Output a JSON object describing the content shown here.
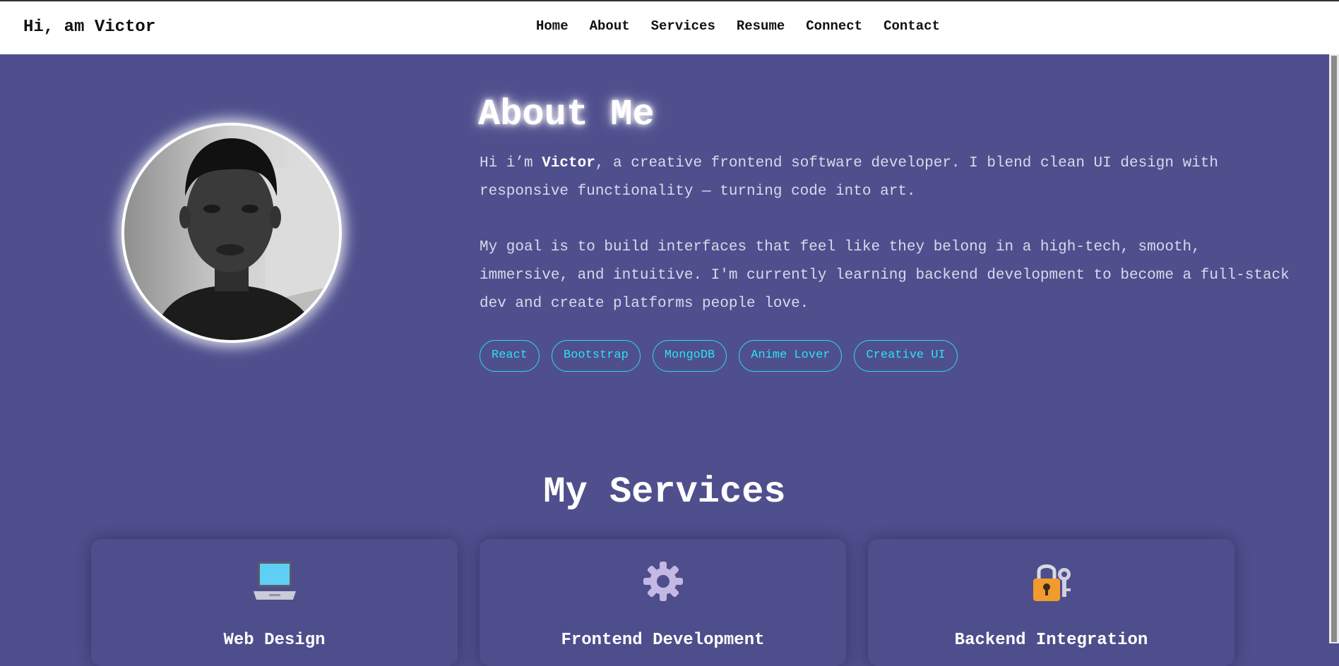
{
  "header": {
    "brand": "Hi, am Victor",
    "nav": [
      "Home",
      "About",
      "Services",
      "Resume",
      "Connect",
      "Contact"
    ]
  },
  "about": {
    "title": "About Me",
    "intro_prefix": "Hi i’m ",
    "intro_name": "Victor",
    "intro_rest": ", a creative frontend software developer. I blend clean UI design with responsive functionality — turning code into art.",
    "goal": "My goal is to build interfaces that feel like they belong in a high-tech, smooth, immersive, and intuitive. I'm currently learning backend development to become a full-stack dev and create platforms people love.",
    "avatar_alt": "portrait photo",
    "tags": [
      "React",
      "Bootstrap",
      "MongoDB",
      "Anime Lover",
      "Creative UI"
    ]
  },
  "services": {
    "title": "My Services",
    "cards": [
      {
        "icon": "laptop-icon",
        "title": "Web Design"
      },
      {
        "icon": "gear-icon",
        "title": "Frontend Development"
      },
      {
        "icon": "lock-key-icon",
        "title": "Backend Integration"
      }
    ]
  },
  "colors": {
    "background": "#4f4f8e",
    "accent": "#2ee0f0",
    "header_bg": "#ffffff"
  }
}
